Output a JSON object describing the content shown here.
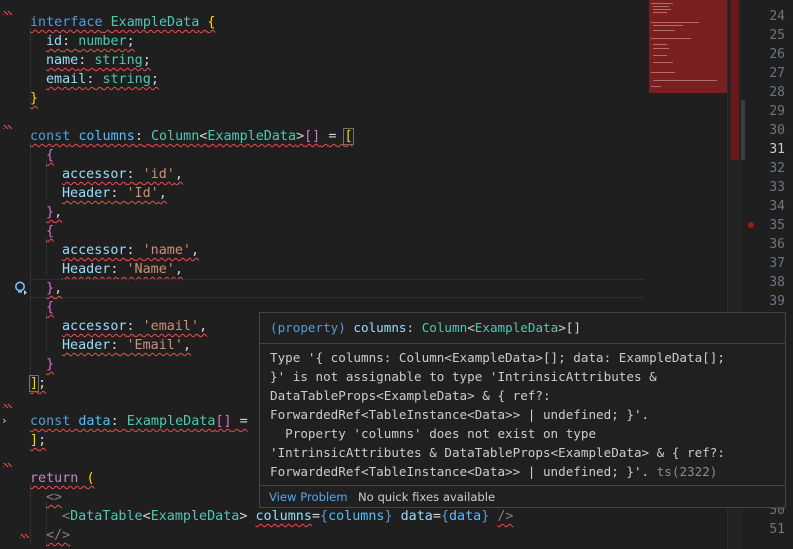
{
  "code": {
    "l1": {
      "kw": "interface",
      "name": "ExampleData",
      "brace": "{"
    },
    "l2": {
      "prop": "id",
      "colon": ":",
      "type": "number",
      "semi": ";"
    },
    "l3": {
      "prop": "name",
      "colon": ":",
      "type": "string",
      "semi": ";"
    },
    "l4": {
      "prop": "email",
      "colon": ":",
      "type": "string",
      "semi": ";"
    },
    "l5": {
      "brace": "}"
    },
    "l7": {
      "kw": "const",
      "name": "columns",
      "colon": ":",
      "type": "Column",
      "lt": "<",
      "generic": "ExampleData",
      "gt": ">",
      "arr": "[]",
      "eq": "=",
      "bracket": "["
    },
    "l8": {
      "brace": "{"
    },
    "l9": {
      "prop": "accessor",
      "colon": ":",
      "val": "'id'",
      "comma": ","
    },
    "l10": {
      "prop": "Header",
      "colon": ":",
      "val": "'Id'",
      "comma": ","
    },
    "l11": {
      "brace": "}",
      "comma": ","
    },
    "l12": {
      "brace": "{"
    },
    "l13": {
      "prop": "accessor",
      "colon": ":",
      "val": "'name'",
      "comma": ","
    },
    "l14": {
      "prop": "Header",
      "colon": ":",
      "val": "'Name'",
      "comma": ","
    },
    "l15": {
      "brace": "}",
      "comma": ","
    },
    "l16": {
      "brace": "{"
    },
    "l17": {
      "prop": "accessor",
      "colon": ":",
      "val": "'email'",
      "comma": ","
    },
    "l18": {
      "prop": "Header",
      "colon": ":",
      "val": "'Email'",
      "comma": ","
    },
    "l19": {
      "brace": "}"
    },
    "l20": {
      "bracket": "]",
      "semi": ";"
    },
    "l22": {
      "kw": "const",
      "name": "data",
      "colon": ":",
      "type": "ExampleData",
      "arr": "[]",
      "eq": "="
    },
    "l23": {
      "bracket": "]",
      "semi": ";"
    },
    "l25": {
      "kw": "return",
      "paren": "("
    },
    "l26": {
      "frag": "<>"
    },
    "l27": {
      "lt": "<",
      "tag": "DataTable",
      "glt": "<",
      "generic": "ExampleData",
      "ggt": ">",
      "attr1": "columns",
      "eq1": "=",
      "ob1": "{",
      "v1": "columns",
      "cb1": "}",
      "attr2": "data",
      "eq2": "=",
      "ob2": "{",
      "v2": "data",
      "cb2": "}",
      "close": "/>"
    },
    "l28": {
      "frag": "</>"
    }
  },
  "line_numbers": {
    "visible": [
      "24",
      "25",
      "26",
      "27",
      "28",
      "29",
      "30",
      "31",
      "32",
      "33",
      "34",
      "35",
      "36",
      "37",
      "38",
      "39"
    ],
    "bottom": [
      "50",
      "51"
    ],
    "active": "31"
  },
  "hover": {
    "signature": {
      "prefix": "(property)",
      "name": "columns",
      "colon": ":",
      "type": "Column",
      "lt": "<",
      "generic": "ExampleData",
      "gt": ">[]"
    },
    "message_lines": [
      "Type '{ columns: Column<ExampleData>[]; data: ExampleData[];",
      "}' is not assignable to type 'IntrinsicAttributes &",
      "DataTableProps<ExampleData> & { ref?:",
      "ForwardedRef<TableInstance<Data>> | undefined; }'.",
      "  Property 'columns' does not exist on type",
      "'IntrinsicAttributes & DataTableProps<ExampleData> & { ref?:",
      "ForwardedRef<TableInstance<Data>> | undefined; }'."
    ],
    "code": "ts(2322)",
    "view_problem": "View Problem",
    "no_fixes": "No quick fixes available"
  },
  "colors": {
    "error": "#f14c4c",
    "link": "#4daafc",
    "keyword": "#569cd6",
    "type": "#4ec9b0",
    "property": "#9cdcfe",
    "string": "#ce9178"
  },
  "icons": [
    "lightbulb-icon"
  ]
}
